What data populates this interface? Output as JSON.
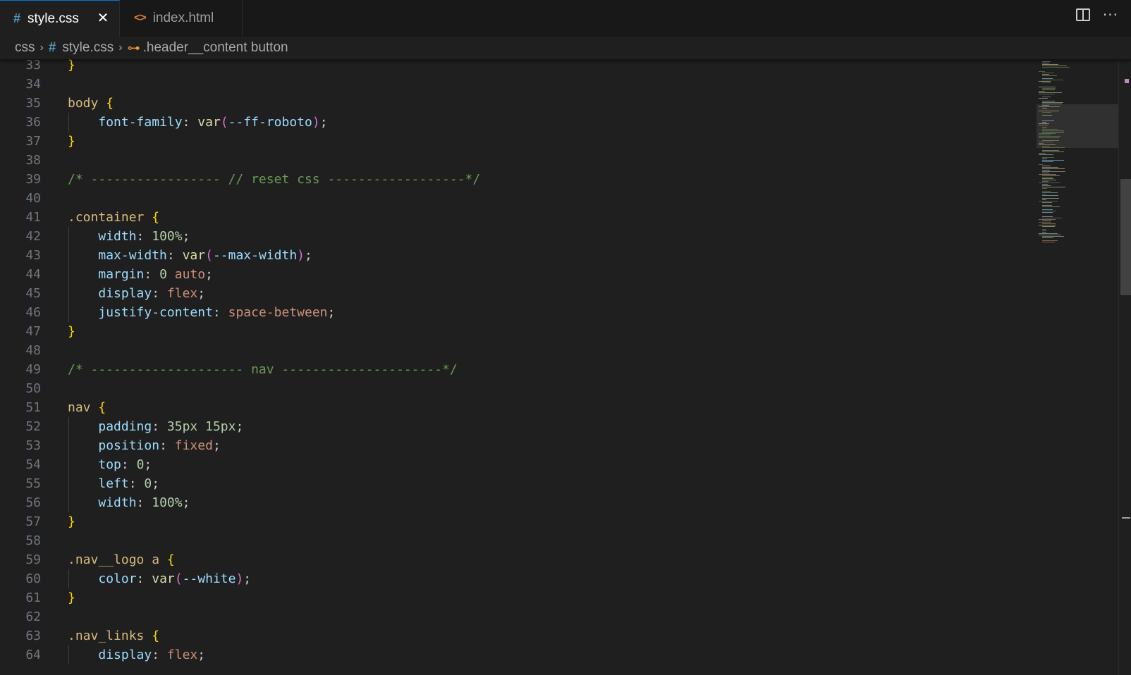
{
  "tabs": [
    {
      "label": "style.css",
      "icon": "#",
      "icon_name": "css-file-icon",
      "active": true,
      "close_glyph": "✕"
    },
    {
      "label": "index.html",
      "icon": "<>",
      "icon_name": "html-file-icon",
      "active": false
    }
  ],
  "actions": {
    "split_icon": "split-editor-icon",
    "more_glyph": "···"
  },
  "breadcrumb": {
    "folder": "css",
    "file": "style.css",
    "file_icon": "#",
    "symbol": ".header__content button",
    "symbol_icon": "⊶",
    "separator": "›"
  },
  "colors": {
    "editor_bg": "#1f1f1f",
    "selector": "#d7ba7d",
    "property": "#9cdcfe",
    "number": "#b5cea8",
    "string_value": "#ce9178",
    "comment": "#6a9955",
    "bracket": "#ffd700",
    "paren": "#da70d6",
    "accent": "#0078d4"
  },
  "editor": {
    "lines": [
      {
        "n": "33",
        "tokens": [
          {
            "t": "}",
            "c": "brace"
          }
        ]
      },
      {
        "n": "34",
        "tokens": []
      },
      {
        "n": "35",
        "tokens": [
          {
            "t": "body",
            "c": "sel"
          },
          {
            "t": " ",
            "c": "punc"
          },
          {
            "t": "{",
            "c": "brace"
          }
        ]
      },
      {
        "n": "36",
        "tokens": [
          {
            "t": "    ",
            "c": "punc"
          },
          {
            "t": "font-family",
            "c": "prop"
          },
          {
            "t": ": ",
            "c": "punc"
          },
          {
            "t": "var",
            "c": "fn"
          },
          {
            "t": "(",
            "c": "paren"
          },
          {
            "t": "--ff-roboto",
            "c": "var"
          },
          {
            "t": ")",
            "c": "paren"
          },
          {
            "t": ";",
            "c": "punc"
          }
        ]
      },
      {
        "n": "37",
        "tokens": [
          {
            "t": "}",
            "c": "brace"
          }
        ]
      },
      {
        "n": "38",
        "tokens": []
      },
      {
        "n": "39",
        "tokens": [
          {
            "t": "/* ----------------- // reset css ------------------*/",
            "c": "cmt"
          }
        ]
      },
      {
        "n": "40",
        "tokens": []
      },
      {
        "n": "41",
        "tokens": [
          {
            "t": ".container",
            "c": "sel"
          },
          {
            "t": " ",
            "c": "punc"
          },
          {
            "t": "{",
            "c": "brace"
          }
        ]
      },
      {
        "n": "42",
        "tokens": [
          {
            "t": "    ",
            "c": "punc"
          },
          {
            "t": "width",
            "c": "prop"
          },
          {
            "t": ": ",
            "c": "punc"
          },
          {
            "t": "100%",
            "c": "num"
          },
          {
            "t": ";",
            "c": "punc"
          }
        ]
      },
      {
        "n": "43",
        "tokens": [
          {
            "t": "    ",
            "c": "punc"
          },
          {
            "t": "max-width",
            "c": "prop"
          },
          {
            "t": ": ",
            "c": "punc"
          },
          {
            "t": "var",
            "c": "fn"
          },
          {
            "t": "(",
            "c": "paren"
          },
          {
            "t": "--max-width",
            "c": "var"
          },
          {
            "t": ")",
            "c": "paren"
          },
          {
            "t": ";",
            "c": "punc"
          }
        ]
      },
      {
        "n": "44",
        "tokens": [
          {
            "t": "    ",
            "c": "punc"
          },
          {
            "t": "margin",
            "c": "prop"
          },
          {
            "t": ": ",
            "c": "punc"
          },
          {
            "t": "0",
            "c": "num"
          },
          {
            "t": " ",
            "c": "punc"
          },
          {
            "t": "auto",
            "c": "val"
          },
          {
            "t": ";",
            "c": "punc"
          }
        ]
      },
      {
        "n": "45",
        "tokens": [
          {
            "t": "    ",
            "c": "punc"
          },
          {
            "t": "display",
            "c": "prop"
          },
          {
            "t": ": ",
            "c": "punc"
          },
          {
            "t": "flex",
            "c": "val"
          },
          {
            "t": ";",
            "c": "punc"
          }
        ]
      },
      {
        "n": "46",
        "tokens": [
          {
            "t": "    ",
            "c": "punc"
          },
          {
            "t": "justify-content",
            "c": "prop"
          },
          {
            "t": ": ",
            "c": "punc"
          },
          {
            "t": "space-between",
            "c": "val"
          },
          {
            "t": ";",
            "c": "punc"
          }
        ]
      },
      {
        "n": "47",
        "tokens": [
          {
            "t": "}",
            "c": "brace"
          }
        ]
      },
      {
        "n": "48",
        "tokens": []
      },
      {
        "n": "49",
        "tokens": [
          {
            "t": "/* -------------------- nav ---------------------*/",
            "c": "cmt"
          }
        ]
      },
      {
        "n": "50",
        "tokens": []
      },
      {
        "n": "51",
        "tokens": [
          {
            "t": "nav",
            "c": "sel"
          },
          {
            "t": " ",
            "c": "punc"
          },
          {
            "t": "{",
            "c": "brace"
          }
        ]
      },
      {
        "n": "52",
        "tokens": [
          {
            "t": "    ",
            "c": "punc"
          },
          {
            "t": "padding",
            "c": "prop"
          },
          {
            "t": ": ",
            "c": "punc"
          },
          {
            "t": "35px",
            "c": "num"
          },
          {
            "t": " ",
            "c": "punc"
          },
          {
            "t": "15px",
            "c": "num"
          },
          {
            "t": ";",
            "c": "punc"
          }
        ]
      },
      {
        "n": "53",
        "tokens": [
          {
            "t": "    ",
            "c": "punc"
          },
          {
            "t": "position",
            "c": "prop"
          },
          {
            "t": ": ",
            "c": "punc"
          },
          {
            "t": "fixed",
            "c": "val"
          },
          {
            "t": ";",
            "c": "punc"
          }
        ]
      },
      {
        "n": "54",
        "tokens": [
          {
            "t": "    ",
            "c": "punc"
          },
          {
            "t": "top",
            "c": "prop"
          },
          {
            "t": ": ",
            "c": "punc"
          },
          {
            "t": "0",
            "c": "num"
          },
          {
            "t": ";",
            "c": "punc"
          }
        ]
      },
      {
        "n": "55",
        "tokens": [
          {
            "t": "    ",
            "c": "punc"
          },
          {
            "t": "left",
            "c": "prop"
          },
          {
            "t": ": ",
            "c": "punc"
          },
          {
            "t": "0",
            "c": "num"
          },
          {
            "t": ";",
            "c": "punc"
          }
        ]
      },
      {
        "n": "56",
        "tokens": [
          {
            "t": "    ",
            "c": "punc"
          },
          {
            "t": "width",
            "c": "prop"
          },
          {
            "t": ": ",
            "c": "punc"
          },
          {
            "t": "100%",
            "c": "num"
          },
          {
            "t": ";",
            "c": "punc"
          }
        ]
      },
      {
        "n": "57",
        "tokens": [
          {
            "t": "}",
            "c": "brace"
          }
        ]
      },
      {
        "n": "58",
        "tokens": []
      },
      {
        "n": "59",
        "tokens": [
          {
            "t": ".nav__logo a",
            "c": "sel"
          },
          {
            "t": " ",
            "c": "punc"
          },
          {
            "t": "{",
            "c": "brace"
          }
        ]
      },
      {
        "n": "60",
        "tokens": [
          {
            "t": "    ",
            "c": "punc"
          },
          {
            "t": "color",
            "c": "prop"
          },
          {
            "t": ": ",
            "c": "punc"
          },
          {
            "t": "var",
            "c": "fn"
          },
          {
            "t": "(",
            "c": "paren"
          },
          {
            "t": "--white",
            "c": "var"
          },
          {
            "t": ")",
            "c": "paren"
          },
          {
            "t": ";",
            "c": "punc"
          }
        ]
      },
      {
        "n": "61",
        "tokens": [
          {
            "t": "}",
            "c": "brace"
          }
        ]
      },
      {
        "n": "62",
        "tokens": []
      },
      {
        "n": "63",
        "tokens": [
          {
            "t": ".nav_links",
            "c": "sel"
          },
          {
            "t": " ",
            "c": "punc"
          },
          {
            "t": "{",
            "c": "brace"
          }
        ]
      },
      {
        "n": "64",
        "tokens": [
          {
            "t": "    ",
            "c": "punc"
          },
          {
            "t": "display",
            "c": "prop"
          },
          {
            "t": ": ",
            "c": "punc"
          },
          {
            "t": "flex",
            "c": "val"
          },
          {
            "t": ";",
            "c": "punc"
          }
        ]
      }
    ]
  }
}
